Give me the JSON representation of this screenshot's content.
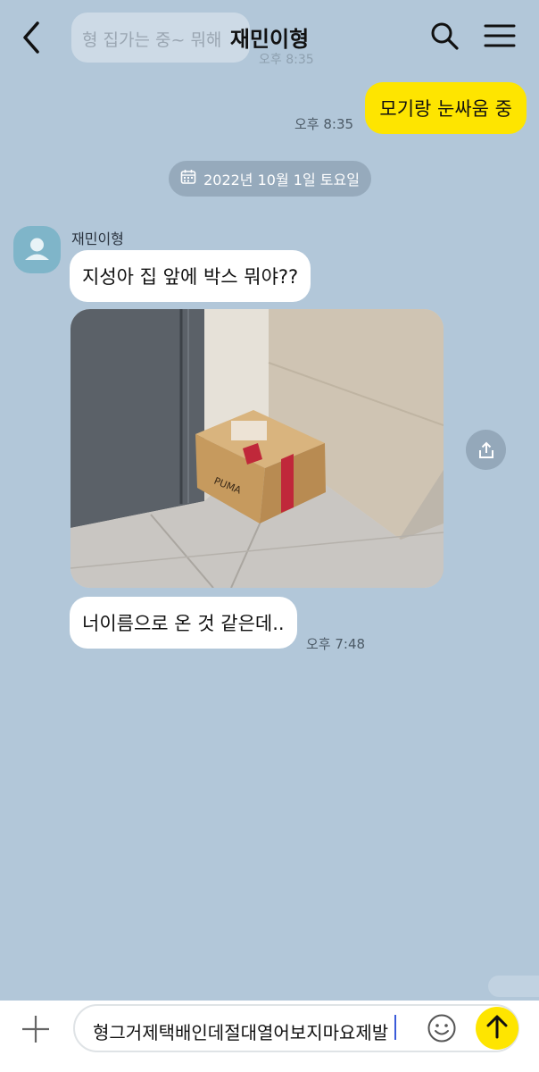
{
  "header": {
    "title": "재민이형",
    "icons": {
      "back": "chevron-left-icon",
      "search": "search-icon",
      "menu": "hamburger-menu-icon"
    }
  },
  "ghost": {
    "text": "형 집가는 중~ 뭐해",
    "time": "오후 8:35"
  },
  "messages": {
    "my": {
      "text": "모기랑 눈싸움 중",
      "time": "오후 8:35"
    },
    "date": {
      "label": "2022년 10월 1일 토요일",
      "icon": "calendar-icon"
    },
    "sender": {
      "name": "재민이형"
    },
    "their1": {
      "text": "지성아 집 앞에 박스 뭐야??"
    },
    "their2": {
      "text": "너이름으로 온 것 같은데..",
      "time": "오후 7:48"
    },
    "photo": {
      "description_icon": "photo-box-at-door"
    }
  },
  "input": {
    "text": "형그거제택배인데절대열어보지마요제발",
    "icons": {
      "plus": "plus-icon",
      "emoji": "emoji-icon",
      "send": "send-arrow-icon"
    }
  },
  "colors": {
    "background": "#b2c7d9",
    "my_bubble": "#fee500",
    "their_bubble": "#ffffff",
    "send_button": "#fee500",
    "avatar": "#7fb5c9"
  }
}
